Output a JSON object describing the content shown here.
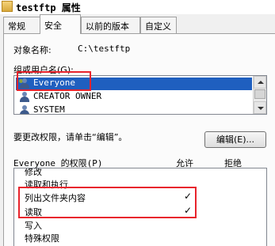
{
  "window": {
    "title": "testftp 属性"
  },
  "tabs": [
    {
      "label": "常规",
      "active": false
    },
    {
      "label": "安全",
      "active": true
    },
    {
      "label": "以前的版本",
      "active": false
    },
    {
      "label": "自定义",
      "active": false
    }
  ],
  "object": {
    "label": "对象名称:",
    "value": "C:\\testftp"
  },
  "users": {
    "label": "组或用户名(G):",
    "items": [
      {
        "name": "Everyone",
        "selected": true
      },
      {
        "name": "CREATOR OWNER",
        "selected": false
      },
      {
        "name": "SYSTEM",
        "selected": false
      }
    ]
  },
  "edit": {
    "hint": "要更改权限，请单击“编辑”。",
    "button_label": "编辑(E)..."
  },
  "permissions": {
    "header": "Everyone 的权限(P)",
    "allow_header": "允许",
    "deny_header": "拒绝",
    "rows": [
      {
        "name": "修改",
        "allow": "",
        "deny": ""
      },
      {
        "name": "读取和执行",
        "allow": "",
        "deny": ""
      },
      {
        "name": "列出文件夹内容",
        "allow": "✓",
        "deny": ""
      },
      {
        "name": "读取",
        "allow": "✓",
        "deny": ""
      },
      {
        "name": "写入",
        "allow": "",
        "deny": ""
      },
      {
        "name": "特殊权限",
        "allow": "",
        "deny": ""
      }
    ]
  },
  "colors": {
    "highlight": "#e8232c",
    "selection": "#1f5fbf"
  }
}
